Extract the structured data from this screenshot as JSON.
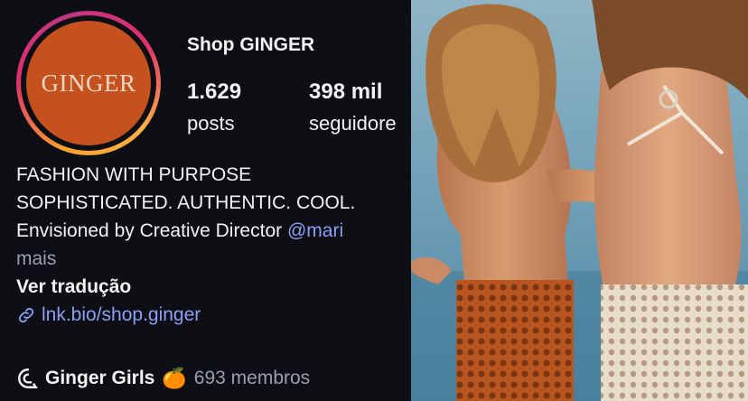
{
  "profile": {
    "avatar_text": "GINGER",
    "name": "Shop GINGER",
    "posts_count": "1.629",
    "posts_label": "posts",
    "followers_count": "398 mil",
    "followers_label": "seguidore"
  },
  "bio": {
    "line1": "FASHION WITH PURPOSE",
    "line2": "SOPHISTICATED. AUTHENTIC. COOL.",
    "line3_prefix": "Envisioned by Creative Director ",
    "line3_mention": "@mari",
    "more": "mais",
    "translate": "Ver tradução",
    "link": "lnk.bio/shop.ginger",
    "link_icon": "link-icon"
  },
  "channel": {
    "icon": "broadcast-channel-icon",
    "name": "Ginger Girls",
    "emoji": "🍊",
    "members": "693 membros"
  },
  "colors": {
    "background": "#0d0f14",
    "avatar": "#c5511f",
    "link": "#8c9ef5"
  }
}
